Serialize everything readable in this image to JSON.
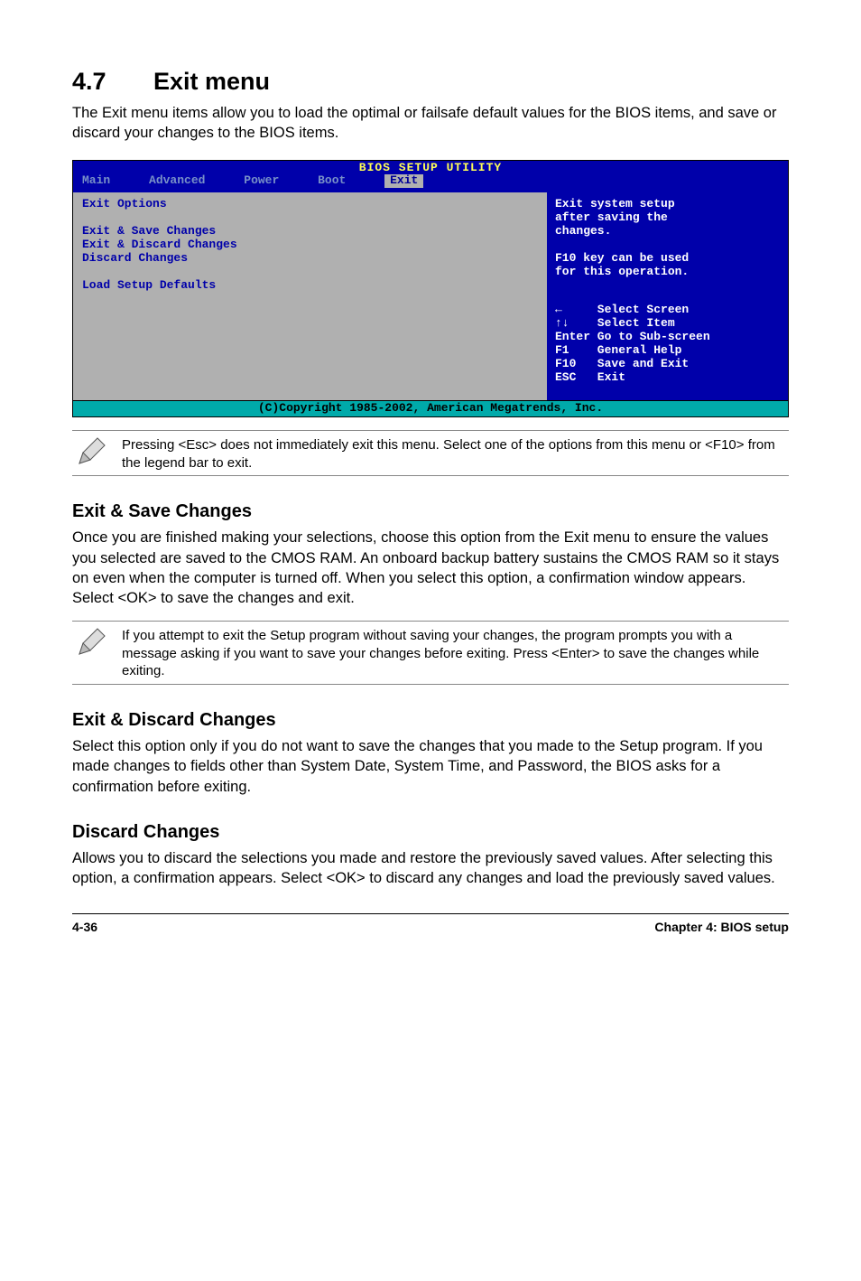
{
  "section": {
    "number": "4.7",
    "title": "Exit menu"
  },
  "intro": "The Exit menu items allow you to load the optimal or failsafe default values for the BIOS items, and save or discard your changes to the BIOS items.",
  "bios": {
    "title": "BIOS SETUP UTILITY",
    "tabs": [
      "Main",
      "Advanced",
      "Power",
      "Boot",
      "Exit"
    ],
    "active_tab": "Exit",
    "left_heading": "Exit Options",
    "left_items": "Exit & Save Changes\nExit & Discard Changes\nDiscard Changes\n\nLoad Setup Defaults",
    "right_help": "Exit system setup\nafter saving the\nchanges.\n\nF10 key can be used\nfor this operation.",
    "right_keys": "←     Select Screen\n↑↓    Select Item\nEnter Go to Sub-screen\nF1    General Help\nF10   Save and Exit\nESC   Exit",
    "copyright": "(C)Copyright 1985-2002, American Megatrends, Inc."
  },
  "note1": "Pressing <Esc> does not immediately exit this menu. Select one of the options from this menu or <F10> from the legend bar to exit.",
  "sub1": {
    "title": "Exit & Save Changes",
    "body": "Once you are finished making your selections, choose this option from the Exit menu to ensure the values you selected are saved to the CMOS RAM. An onboard backup battery sustains the CMOS RAM so it stays on even when the computer is turned off. When you select this option, a confirmation window appears. Select <OK> to save the changes and exit."
  },
  "note2": "If you attempt to exit the Setup program without saving your changes, the program prompts you with a message asking if you want to save your changes before exiting. Press <Enter> to save the changes while exiting.",
  "sub2": {
    "title": "Exit & Discard Changes",
    "body": "Select this option only if you do not want to save the changes that you made to the Setup program. If you made changes to fields other than System Date, System Time, and Password, the BIOS asks for a confirmation before exiting."
  },
  "sub3": {
    "title": "Discard Changes",
    "body": "Allows you to discard the selections you made and restore the previously saved values. After selecting this option, a confirmation appears. Select <OK> to discard any changes and load the previously saved values."
  },
  "footer": {
    "left": "4-36",
    "right": "Chapter 4: BIOS setup"
  }
}
